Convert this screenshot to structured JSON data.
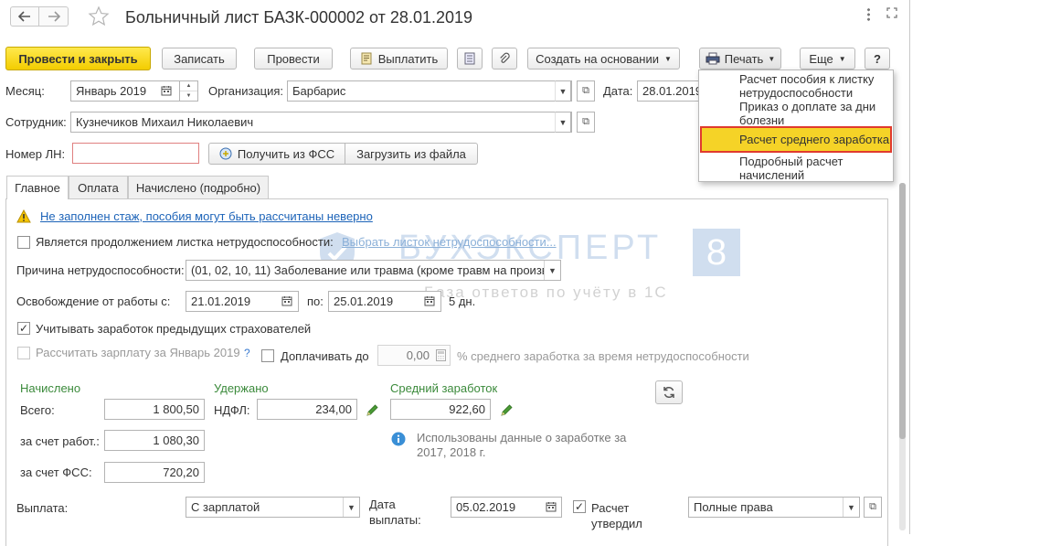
{
  "window": {
    "title": "Больничный лист БАЗК-000002 от 28.01.2019",
    "back_icon": "arrow-left-icon",
    "forward_icon": "arrow-right-icon",
    "star_icon": "star-icon",
    "menu_icon": "more-vertical-icon",
    "maximize_icon": "maximize-icon",
    "close_icon": "close-icon"
  },
  "toolbar": {
    "post_and_close": "Провести и закрыть",
    "save": "Записать",
    "post": "Провести",
    "pay": "Выплатить",
    "create_based_on": "Создать на основании",
    "print": "Печать",
    "more": "Еще",
    "help": "?"
  },
  "print_menu": {
    "items": [
      "Расчет пособия к листку нетрудоспособности",
      "Приказ о доплате за дни болезни",
      "Расчет среднего заработка",
      "Подробный расчет начислений"
    ],
    "highlighted_index": 2
  },
  "header": {
    "month_label": "Месяц:",
    "month_value": "Январь 2019",
    "org_label": "Организация:",
    "org_value": "Барбарис",
    "date_label": "Дата:",
    "date_value": "28.01.2019",
    "employee_label": "Сотрудник:",
    "employee_value": "Кузнечиков Михаил Николаевич",
    "ln_label": "Номер ЛН:",
    "ln_value": "",
    "get_from_fss": "Получить из ФСС",
    "load_from_file": "Загрузить из файла"
  },
  "tabs": [
    "Главное",
    "Оплата",
    "Начислено (подробно)"
  ],
  "main": {
    "warning_link": "Не заполнен стаж, пособия могут быть рассчитаны неверно",
    "continuation_label": "Является продолжением листка нетрудоспособности:",
    "continuation_link": "Выбрать листок нетрудоспособности...",
    "reason_label": "Причина нетрудоспособности:",
    "reason_value": "(01, 02, 10, 11) Заболевание или травма (кроме травм на произв",
    "release_label": "Освобождение от работы с:",
    "release_from": "21.01.2019",
    "to_label": "по:",
    "release_to": "25.01.2019",
    "days_text": "5 дн.",
    "consider_prev_label": "Учитывать заработок предыдущих страхователей",
    "consider_prev_checked": true,
    "calc_salary_label": "Рассчитать зарплату за Январь 2019",
    "calc_salary_help": "?",
    "topup_label": "Доплачивать до",
    "topup_value": "0,00",
    "topup_suffix": "% среднего заработка за время нетрудоспособности",
    "accrued_header": "Начислено",
    "total_label": "Всего:",
    "total_value": "1 800,50",
    "employer_label": "за счет работ.:",
    "employer_value": "1 080,30",
    "fss_label": "за счет ФСС:",
    "fss_value": "720,20",
    "withheld_header": "Удержано",
    "ndfl_label": "НДФЛ:",
    "ndfl_value": "234,00",
    "avg_header": "Средний заработок",
    "avg_value": "922,60",
    "info_text_1": "Использованы данные о заработке за",
    "info_text_2": "2017,  2018 г.",
    "payment_label": "Выплата:",
    "payment_value": "С зарплатой",
    "pay_date_label_1": "Дата",
    "pay_date_label_2": "выплаты:",
    "pay_date_value": "05.02.2019",
    "approved_label_1": "Расчет",
    "approved_label_2": "утвердил",
    "approved_checked": true,
    "rights_value": "Полные права"
  },
  "watermark": {
    "brand": "БУХЭКСПЕРТ",
    "digit": "8",
    "tagline": "База ответов по учёту в 1С"
  },
  "colors": {
    "primary_button": "#f3cd00",
    "highlight": "#f5d327",
    "highlight_border": "#e03a2e",
    "green_labels": "#3b8a3b",
    "link": "#1c63b8"
  }
}
